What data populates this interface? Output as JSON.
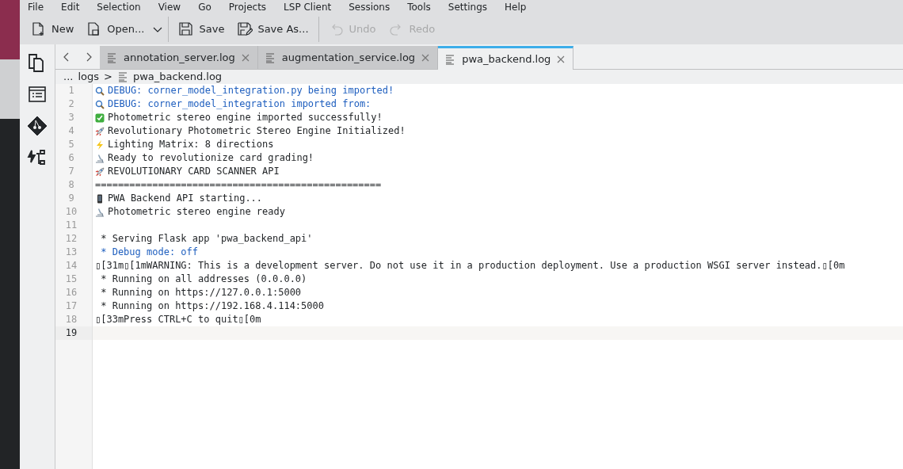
{
  "menu": [
    "File",
    "Edit",
    "Selection",
    "View",
    "Go",
    "Projects",
    "LSP Client",
    "Sessions",
    "Tools",
    "Settings",
    "Help"
  ],
  "toolbar": [
    {
      "kind": "new",
      "label": "New",
      "disabled": false
    },
    {
      "kind": "open",
      "label": "Open...",
      "disabled": false
    },
    {
      "kind": "dropdown",
      "disabled": false
    },
    {
      "kind": "separator"
    },
    {
      "kind": "save",
      "label": "Save",
      "disabled": false
    },
    {
      "kind": "saveas",
      "label": "Save As...",
      "disabled": false
    },
    {
      "kind": "separator"
    },
    {
      "kind": "undo",
      "label": "Undo",
      "disabled": true
    },
    {
      "kind": "redo",
      "label": "Redo",
      "disabled": true
    }
  ],
  "sidebar": [
    {
      "kind": "documents"
    },
    {
      "kind": "list"
    },
    {
      "kind": "git"
    },
    {
      "kind": "outline"
    }
  ],
  "tabs": [
    {
      "label": "annotation_server.log",
      "selected": false
    },
    {
      "label": "augmentation_service.log",
      "selected": false
    },
    {
      "label": "pwa_backend.log",
      "selected": true
    }
  ],
  "breadcrumb": {
    "ellipsis": "...",
    "folder": "logs",
    "separator": ">",
    "file": "pwa_backend.log"
  },
  "lines": [
    {
      "number": "1",
      "kind": "search",
      "text": "DEBUG: corner_model_integration.py being imported!",
      "color": "#1f5fbf",
      "current": false
    },
    {
      "number": "2",
      "kind": "search",
      "text": "DEBUG: corner_model_integration imported from:",
      "color": "#1f5fbf",
      "current": false
    },
    {
      "number": "3",
      "kind": "check",
      "text": "Photometric stereo engine imported successfully!",
      "color": "#232629",
      "current": false
    },
    {
      "number": "4",
      "kind": "rocket",
      "text": "Revolutionary Photometric Stereo Engine Initialized!",
      "color": "#232629",
      "current": false
    },
    {
      "number": "5",
      "kind": "bolt",
      "text": "Lighting Matrix: 8 directions",
      "color": "#232629",
      "current": false
    },
    {
      "number": "6",
      "kind": "microscope",
      "text": "Ready to revolutionize card grading!",
      "color": "#232629",
      "current": false
    },
    {
      "number": "7",
      "kind": "rocket",
      "text": "REVOLUTIONARY CARD SCANNER API",
      "color": "#232629",
      "current": false
    },
    {
      "number": "8",
      "kind": "text",
      "text": "==================================================",
      "color": "#232629",
      "current": false
    },
    {
      "number": "9",
      "kind": "phone",
      "text": "PWA Backend API starting...",
      "color": "#232629",
      "current": false
    },
    {
      "number": "10",
      "kind": "microscope",
      "text": "Photometric stereo engine ready",
      "color": "#232629",
      "current": false
    },
    {
      "number": "11",
      "kind": "text",
      "current": false
    },
    {
      "number": "12",
      "kind": "text",
      "text": " * Serving Flask app 'pwa_backend_api'",
      "color": "#232629",
      "current": false
    },
    {
      "number": "13",
      "kind": "text",
      "text": " * Debug mode: off",
      "color": "#1f5fbf",
      "current": false
    },
    {
      "number": "14",
      "kind": "text",
      "text": "▯[31m▯[1mWARNING: This is a development server. Do not use it in a production deployment. Use a production WSGI server instead.▯[0m",
      "color": "#232629",
      "current": false
    },
    {
      "number": "15",
      "kind": "text",
      "text": " * Running on all addresses (0.0.0.0)",
      "color": "#232629",
      "current": false
    },
    {
      "number": "16",
      "kind": "text",
      "text": " * Running on https://127.0.0.1:5000",
      "color": "#232629",
      "current": false
    },
    {
      "number": "17",
      "kind": "text",
      "text": " * Running on https://192.168.4.114:5000",
      "color": "#232629",
      "current": false
    },
    {
      "number": "18",
      "kind": "text",
      "text": "▯[33mPress CTRL+C to quit▯[0m",
      "color": "#232629",
      "current": false
    },
    {
      "number": "19",
      "kind": "text",
      "current": true
    }
  ]
}
